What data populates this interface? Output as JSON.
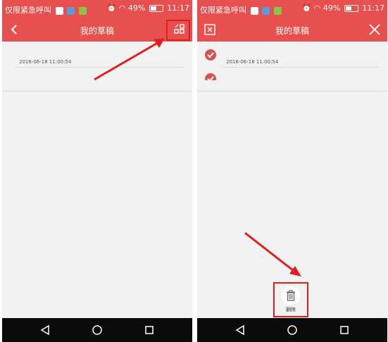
{
  "left_screen": {
    "status_bar": {
      "carrier": "仅限紧急呼叫",
      "battery": "49%",
      "time": "11:17"
    },
    "header": {
      "title": "我的草稿",
      "back_icon": "chevron-left-icon",
      "edit_icon": "grid-edit-icon"
    },
    "drafts": [
      {
        "date": "2016-06-18 11:00:54"
      }
    ],
    "nav": {
      "back": "triangle-back-icon",
      "home": "circle-home-icon",
      "recent": "square-recent-icon"
    }
  },
  "right_screen": {
    "status_bar": {
      "carrier": "仅限紧急呼叫",
      "battery": "49%",
      "time": "11:17"
    },
    "header": {
      "title": "我的草稿",
      "left_icon": "select-all-icon",
      "close_icon": "close-icon"
    },
    "drafts": [
      {
        "date": "2016-06-18 11:00:54",
        "checked": true
      },
      {
        "date": "",
        "checked": true
      }
    ],
    "delete": {
      "label": "删除",
      "icon": "trash-icon"
    },
    "nav": {
      "back": "triangle-back-icon",
      "home": "circle-home-icon",
      "recent": "square-recent-icon"
    }
  },
  "colors": {
    "header": "#e8504f",
    "check": "#d65252",
    "highlight": "#e21d1d",
    "nav_bar": "#0b0b0b"
  }
}
